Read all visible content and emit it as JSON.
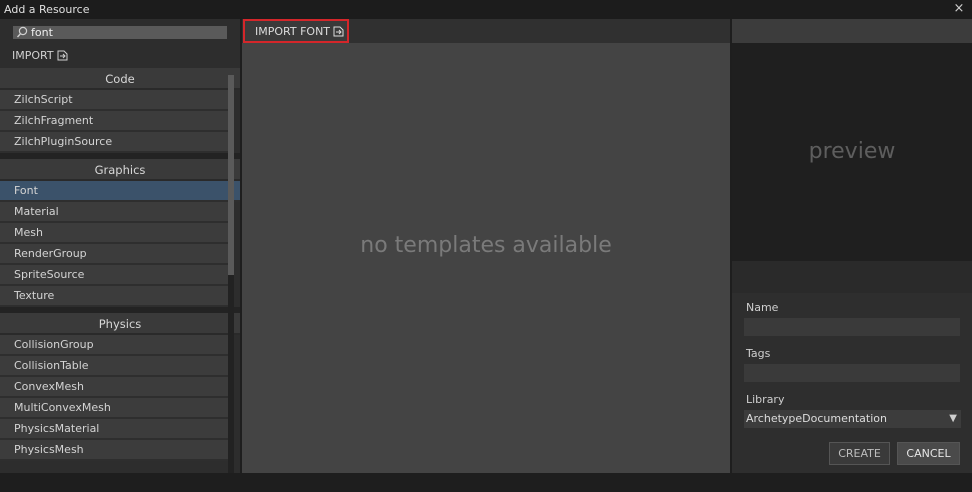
{
  "window": {
    "title": "Add a Resource",
    "close_glyph": "×"
  },
  "search": {
    "value": "font",
    "icon": "search-icon"
  },
  "import": {
    "label": "IMPORT",
    "icon": "import-icon"
  },
  "groups": [
    {
      "name": "Code",
      "items": [
        "ZilchScript",
        "ZilchFragment",
        "ZilchPluginSource"
      ]
    },
    {
      "name": "Graphics",
      "items": [
        "Font",
        "Material",
        "Mesh",
        "RenderGroup",
        "SpriteSource",
        "Texture"
      ]
    },
    {
      "name": "Physics",
      "items": [
        "CollisionGroup",
        "CollisionTable",
        "ConvexMesh",
        "MultiConvexMesh",
        "PhysicsMaterial",
        "PhysicsMesh"
      ]
    }
  ],
  "selected_item": "Font",
  "center": {
    "import_button": "IMPORT FONT",
    "empty_message": "no templates available"
  },
  "right": {
    "preview_label": "preview",
    "name_label": "Name",
    "name_value": "",
    "tags_label": "Tags",
    "tags_value": "",
    "library_label": "Library",
    "library_value": "ArchetypeDocumentation",
    "create_label": "CREATE",
    "cancel_label": "CANCEL"
  },
  "colors": {
    "selection": "#3b526a",
    "highlight_border": "#d4262a"
  }
}
